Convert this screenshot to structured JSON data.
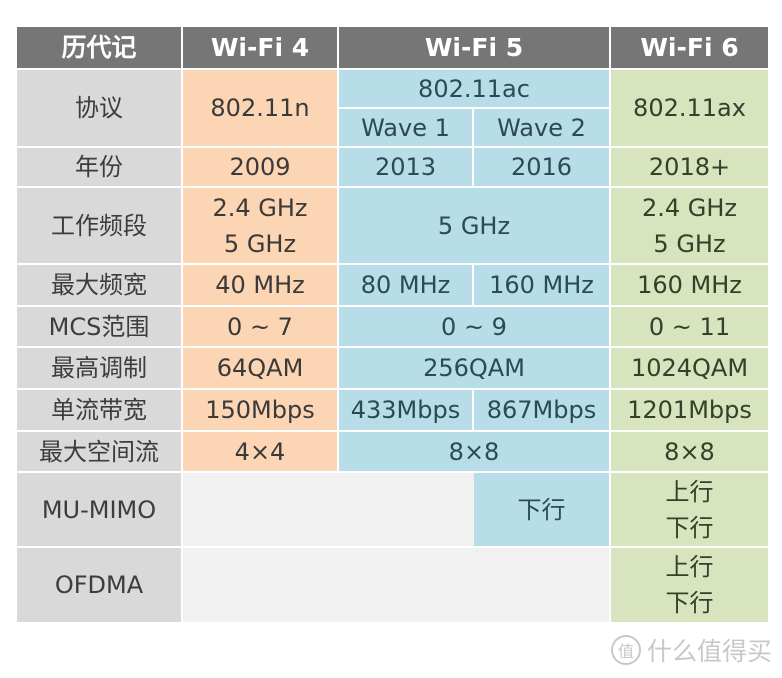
{
  "headers": {
    "label": "历代记",
    "wifi4": "Wi-Fi 4",
    "wifi5": "Wi-Fi 5",
    "wifi6": "Wi-Fi 6"
  },
  "rows": {
    "protocol": {
      "label": "协议",
      "wifi4": "802.11n",
      "wifi5": "802.11ac",
      "wifi5_wave1": "Wave 1",
      "wifi5_wave2": "Wave 2",
      "wifi6": "802.11ax"
    },
    "year": {
      "label": "年份",
      "wifi4": "2009",
      "wifi5_wave1": "2013",
      "wifi5_wave2": "2016",
      "wifi6": "2018+"
    },
    "band": {
      "label": "工作频段",
      "wifi4": [
        "2.4 GHz",
        "5 GHz"
      ],
      "wifi5": "5 GHz",
      "wifi6": [
        "2.4 GHz",
        "5 GHz"
      ]
    },
    "max_bandwidth": {
      "label": "最大频宽",
      "wifi4": "40 MHz",
      "wifi5_wave1": "80 MHz",
      "wifi5_wave2": "160 MHz",
      "wifi6": "160 MHz"
    },
    "mcs": {
      "label": "MCS范围",
      "wifi4": "0 ~ 7",
      "wifi5": "0 ~ 9",
      "wifi6": "0 ~ 11"
    },
    "modulation": {
      "label": "最高调制",
      "wifi4": "64QAM",
      "wifi5": "256QAM",
      "wifi6": "1024QAM"
    },
    "stream_rate": {
      "label": "单流带宽",
      "wifi4": "150Mbps",
      "wifi5_wave1": "433Mbps",
      "wifi5_wave2": "867Mbps",
      "wifi6": "1201Mbps"
    },
    "spatial_streams": {
      "label": "最大空间流",
      "wifi4": "4×4",
      "wifi5": "8×8",
      "wifi6": "8×8"
    },
    "mu_mimo": {
      "label": "MU-MIMO",
      "wifi5_wave2": "下行",
      "wifi6": [
        "上行",
        "下行"
      ]
    },
    "ofdma": {
      "label": "OFDMA",
      "wifi6": [
        "上行",
        "下行"
      ]
    }
  },
  "watermark": {
    "icon": "值",
    "text": "什么值得买"
  }
}
